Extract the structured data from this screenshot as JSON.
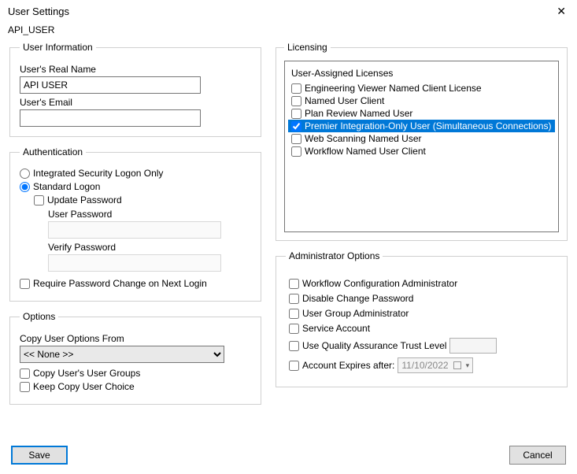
{
  "window": {
    "title": "User Settings",
    "subtitle": "API_USER"
  },
  "userInfo": {
    "legend": "User Information",
    "realNameLabel": "User's Real Name",
    "realNameValue": "API USER",
    "emailLabel": "User's Email",
    "emailValue": ""
  },
  "auth": {
    "legend": "Authentication",
    "integratedLabel": "Integrated Security Logon Only",
    "standardLabel": "Standard Logon",
    "updatePwLabel": "Update Password",
    "userPwLabel": "User Password",
    "verifyPwLabel": "Verify Password",
    "requirePwChangeLabel": "Require Password Change on Next Login"
  },
  "options": {
    "legend": "Options",
    "copyFromLabel": "Copy User Options From",
    "copyFromValue": "<< None >>",
    "copyGroupsLabel": "Copy User's User Groups",
    "keepCopyChoiceLabel": "Keep Copy User Choice"
  },
  "licensing": {
    "legend": "Licensing",
    "header": "User-Assigned Licenses",
    "items": [
      {
        "label": "Engineering Viewer Named Client License",
        "checked": false,
        "selected": false
      },
      {
        "label": "Named User Client",
        "checked": false,
        "selected": false
      },
      {
        "label": "Plan Review Named User",
        "checked": false,
        "selected": false
      },
      {
        "label": "Premier Integration-Only User (Simultaneous Connections)",
        "checked": true,
        "selected": true
      },
      {
        "label": "Web Scanning Named User",
        "checked": false,
        "selected": false
      },
      {
        "label": "Workflow Named User Client",
        "checked": false,
        "selected": false
      }
    ]
  },
  "admin": {
    "legend": "Administrator Options",
    "workflowAdminLabel": "Workflow Configuration Administrator",
    "disableChangePwLabel": "Disable Change Password",
    "userGroupAdminLabel": "User Group Administrator",
    "serviceAccountLabel": "Service Account",
    "useQALabel": "Use Quality Assurance Trust Level",
    "accountExpiresLabel": "Account Expires after:",
    "accountExpiresDate": "11/10/2022"
  },
  "buttons": {
    "save": "Save",
    "cancel": "Cancel"
  }
}
